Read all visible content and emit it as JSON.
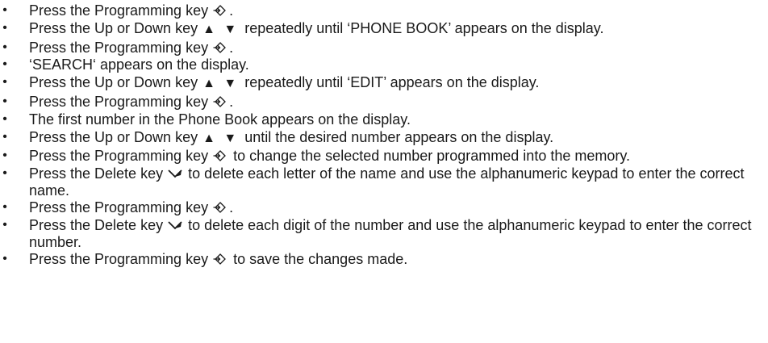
{
  "bullet": "•",
  "icons": {
    "programming_key": "programming-key-icon",
    "delete_key": "delete-key-icon",
    "up_down_keys": "▲ ▼"
  },
  "steps": [
    {
      "before": "Press the Programming key",
      "icon": "programming",
      "after": "."
    },
    {
      "before": "Press the Up or Down key",
      "icon": "updown",
      "after": "repeatedly until ‘PHONE BOOK’ appears on the display."
    },
    {
      "before": "Press the Programming key",
      "icon": "programming",
      "after": "."
    },
    {
      "before": "‘SEARCH‘ appears on the display.",
      "icon": "",
      "after": ""
    },
    {
      "before": "Press the Up or Down key",
      "icon": "updown",
      "after": "repeatedly until ‘EDIT’ appears on the display."
    },
    {
      "before": "Press the Programming key",
      "icon": "programming",
      "after": "."
    },
    {
      "before": "The first number in the Phone Book appears on the display.",
      "icon": "",
      "after": ""
    },
    {
      "before": "Press the Up or Down key",
      "icon": "updown",
      "after": "until the desired number appears on the display."
    },
    {
      "before": "Press the Programming key",
      "icon": "programming",
      "after": "to change the selected number programmed into the memory."
    },
    {
      "before": "Press the Delete key",
      "icon": "delete",
      "after": "to delete each letter of the name and use the alphanumeric keypad to enter the correct name."
    },
    {
      "before": "Press the Programming key",
      "icon": "programming",
      "after": "."
    },
    {
      "before": "Press the Delete key",
      "icon": "delete",
      "after": "to delete each digit of the number and use the alphanumeric keypad to enter the correct number."
    },
    {
      "before": "Press the Programming key",
      "icon": "programming",
      "after": "to save the changes made."
    }
  ]
}
